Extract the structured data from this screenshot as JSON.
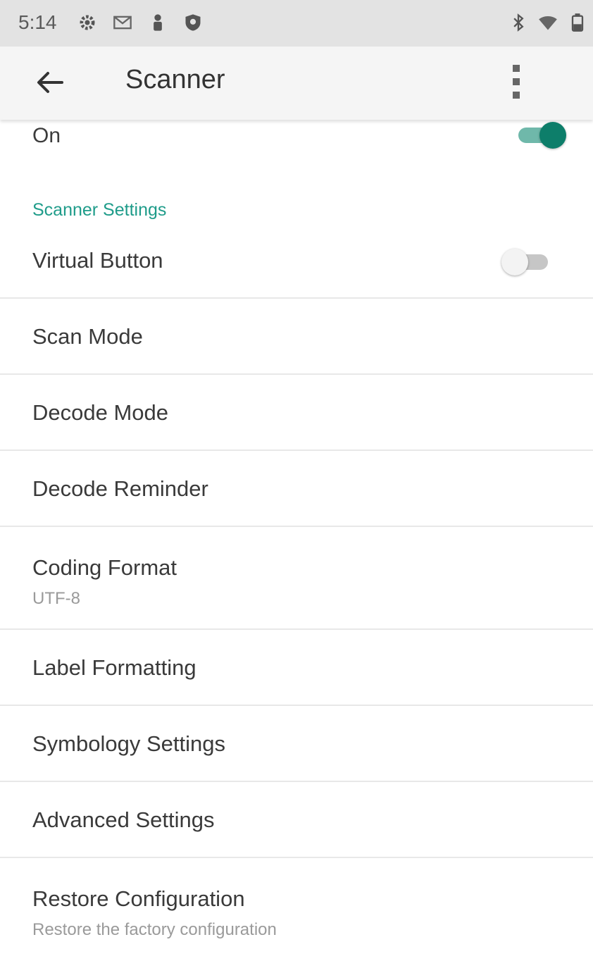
{
  "status_bar": {
    "time": "5:14",
    "left_icons": [
      "settings-icon",
      "mail-icon",
      "person-icon",
      "shield-icon"
    ],
    "right_icons": [
      "bluetooth-icon",
      "wifi-icon",
      "battery-icon"
    ]
  },
  "app_bar": {
    "title": "Scanner",
    "back_icon": "arrow-left-icon",
    "menu_icon": "more-vert-icon"
  },
  "main_switch": {
    "label": "On",
    "checked": true
  },
  "section": {
    "header": "Scanner Settings"
  },
  "items": [
    {
      "title": "Virtual Button",
      "summary": "",
      "toggle": false
    },
    {
      "title": "Scan Mode",
      "summary": ""
    },
    {
      "title": "Decode Mode",
      "summary": ""
    },
    {
      "title": "Decode Reminder",
      "summary": ""
    },
    {
      "title": "Coding Format",
      "summary": "UTF-8"
    },
    {
      "title": "Label Formatting",
      "summary": ""
    },
    {
      "title": "Symbology Settings",
      "summary": ""
    },
    {
      "title": "Advanced Settings",
      "summary": ""
    },
    {
      "title": "Restore Configuration",
      "summary": "Restore the factory configuration"
    }
  ],
  "colors": {
    "accent": "#1f9c8a",
    "toggle_on_thumb": "#0d7e6a",
    "toggle_on_track": "#6fb8aa",
    "status_bar_bg": "#e3e3e3",
    "app_bar_bg": "#f5f5f5"
  }
}
